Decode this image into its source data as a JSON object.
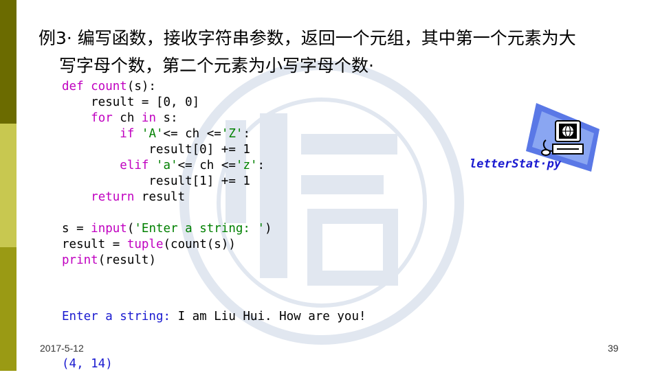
{
  "slide": {
    "title_bullet": "",
    "title_line1": "例3· 编写函数，接收字符串参数，返回一个元组，其中第一个元素为大",
    "title_line2": "写字母个数，第二个元素为小写字母个数·",
    "file_label": "letterStat·py",
    "date": "2017-5-12",
    "page_number": "39"
  },
  "code_lines": [
    [
      {
        "t": "def",
        "c": "kw"
      },
      {
        "t": " count",
        "c": "bi"
      },
      {
        "t": "(s):",
        "c": ""
      }
    ],
    [
      {
        "t": "    result = [0, 0]",
        "c": ""
      }
    ],
    [
      {
        "t": "    ",
        "c": ""
      },
      {
        "t": "for",
        "c": "kw"
      },
      {
        "t": " ch ",
        "c": ""
      },
      {
        "t": "in",
        "c": "kw"
      },
      {
        "t": " s:",
        "c": ""
      }
    ],
    [
      {
        "t": "        ",
        "c": ""
      },
      {
        "t": "if",
        "c": "kw"
      },
      {
        "t": " ",
        "c": ""
      },
      {
        "t": "'A'",
        "c": "str"
      },
      {
        "t": "<= ch <=",
        "c": ""
      },
      {
        "t": "'Z'",
        "c": "str"
      },
      {
        "t": ":",
        "c": ""
      }
    ],
    [
      {
        "t": "            result[0] += 1",
        "c": ""
      }
    ],
    [
      {
        "t": "        ",
        "c": ""
      },
      {
        "t": "elif",
        "c": "kw"
      },
      {
        "t": " ",
        "c": ""
      },
      {
        "t": "'a'",
        "c": "str"
      },
      {
        "t": "<= ch <=",
        "c": ""
      },
      {
        "t": "'z'",
        "c": "str"
      },
      {
        "t": ":",
        "c": ""
      }
    ],
    [
      {
        "t": "            result[1] += 1",
        "c": ""
      }
    ],
    [
      {
        "t": "    ",
        "c": ""
      },
      {
        "t": "return",
        "c": "kw"
      },
      {
        "t": " result",
        "c": ""
      }
    ],
    [
      {
        "t": "",
        "c": ""
      }
    ],
    [
      {
        "t": "s = ",
        "c": ""
      },
      {
        "t": "input",
        "c": "bi"
      },
      {
        "t": "(",
        "c": ""
      },
      {
        "t": "'Enter a string: '",
        "c": "str"
      },
      {
        "t": ")",
        "c": ""
      }
    ],
    [
      {
        "t": "result = ",
        "c": ""
      },
      {
        "t": "tuple",
        "c": "bi"
      },
      {
        "t": "(count(s))",
        "c": ""
      }
    ],
    [
      {
        "t": "print",
        "c": "bi"
      },
      {
        "t": "(result)",
        "c": ""
      }
    ]
  ],
  "output": {
    "prompt": "Enter a string: ",
    "user_input": "I am Liu Hui. How are you!",
    "result": "(4, 14)"
  },
  "icons": {
    "file_icon": "computer-globe-icon",
    "watermark": "university-seal-watermark"
  }
}
